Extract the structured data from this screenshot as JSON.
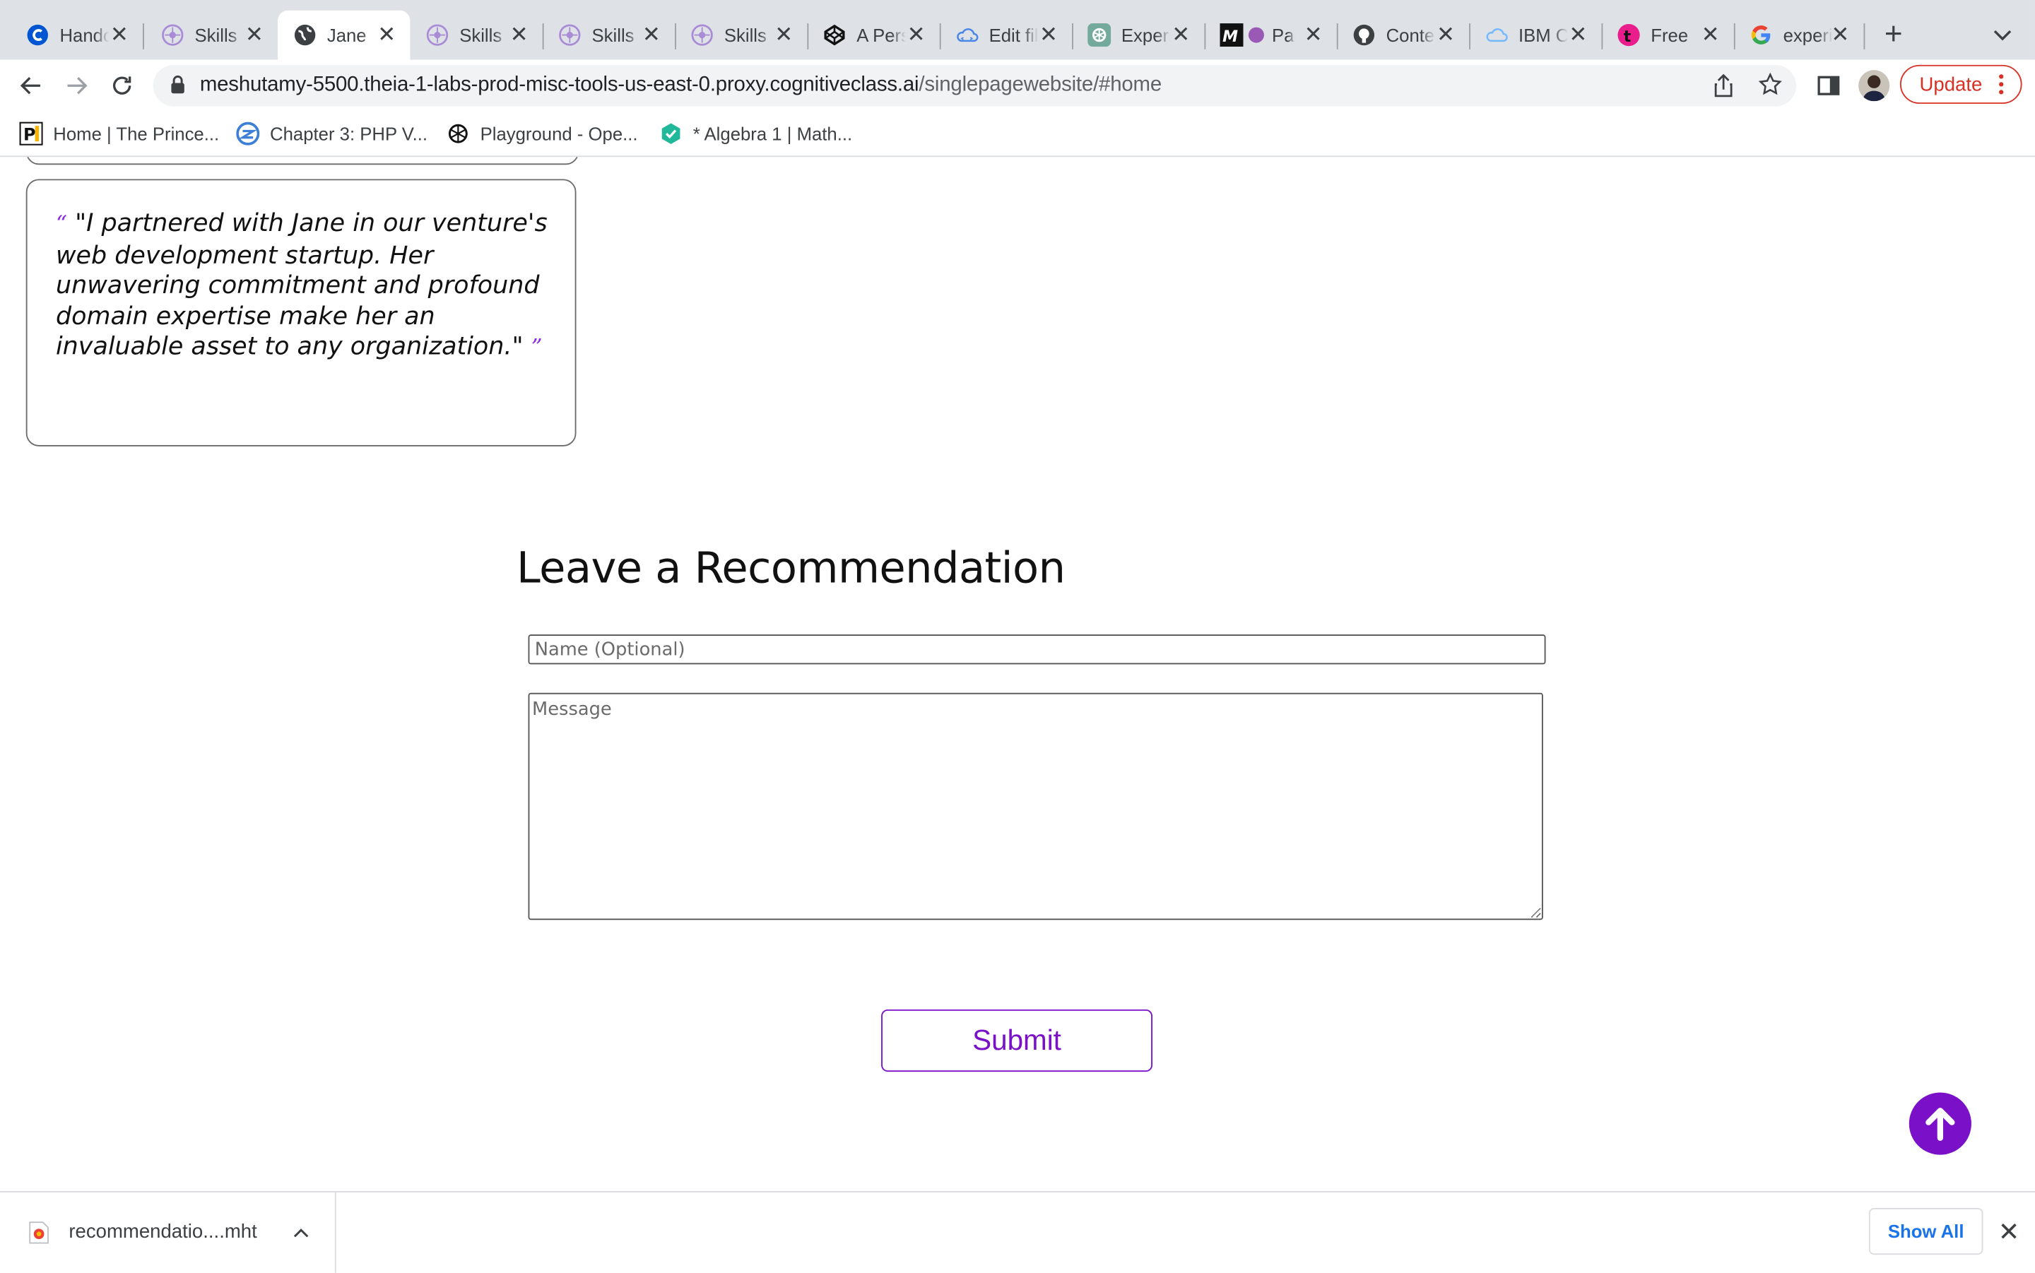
{
  "browser": {
    "tabs": [
      {
        "title": "Handout",
        "icon": "coursera-icon"
      },
      {
        "title": "Skills",
        "icon": "skills-network-icon"
      },
      {
        "title": "Jane",
        "icon": "globe-icon",
        "active": true
      },
      {
        "title": "Skills",
        "icon": "skills-network-icon"
      },
      {
        "title": "Skills",
        "icon": "skills-network-icon"
      },
      {
        "title": "Skills",
        "icon": "skills-network-icon"
      },
      {
        "title": "A Personal",
        "icon": "codepen-icon"
      },
      {
        "title": "Edit file",
        "icon": "cloud-ide-icon"
      },
      {
        "title": "Experiment",
        "icon": "openai-icon"
      },
      {
        "title": "Page",
        "icon": "medium-icon"
      },
      {
        "title": "Contents",
        "icon": "github-icon"
      },
      {
        "title": "IBM Cloud",
        "icon": "ibm-cloud-icon"
      },
      {
        "title": "Free",
        "icon": "tutor-icon"
      },
      {
        "title": "experiment",
        "icon": "google-icon"
      }
    ],
    "url": {
      "host": "meshutamy-5500.theia-1-labs-prod-misc-tools-us-east-0.proxy.cognitiveclass.ai",
      "path": "/singlepagewebsite/#home"
    },
    "update_label": "Update",
    "bookmarks": [
      {
        "label": "Home | The Prince...",
        "icon": "princeton-review-icon"
      },
      {
        "label": "Chapter 3: PHP V...",
        "icon": "zybooks-icon"
      },
      {
        "label": "Playground - Ope...",
        "icon": "openai-icon"
      },
      {
        "label": "* Algebra 1 | Math...",
        "icon": "ixl-icon"
      }
    ]
  },
  "page": {
    "testimonial": {
      "open_quote": "“",
      "text": "\"I partnered with Jane in our venture's web development startup. Her unwavering commitment and profound domain expertise make her an invaluable asset to any organization.\"",
      "close_quote": "”"
    },
    "form": {
      "heading": "Leave a Recommendation",
      "name_placeholder": "Name (Optional)",
      "message_placeholder": "Message",
      "submit_label": "Submit"
    },
    "accent_color": "#7a10c8"
  },
  "downloads": {
    "file_name": "recommendatio....mht",
    "show_all_label": "Show All"
  }
}
